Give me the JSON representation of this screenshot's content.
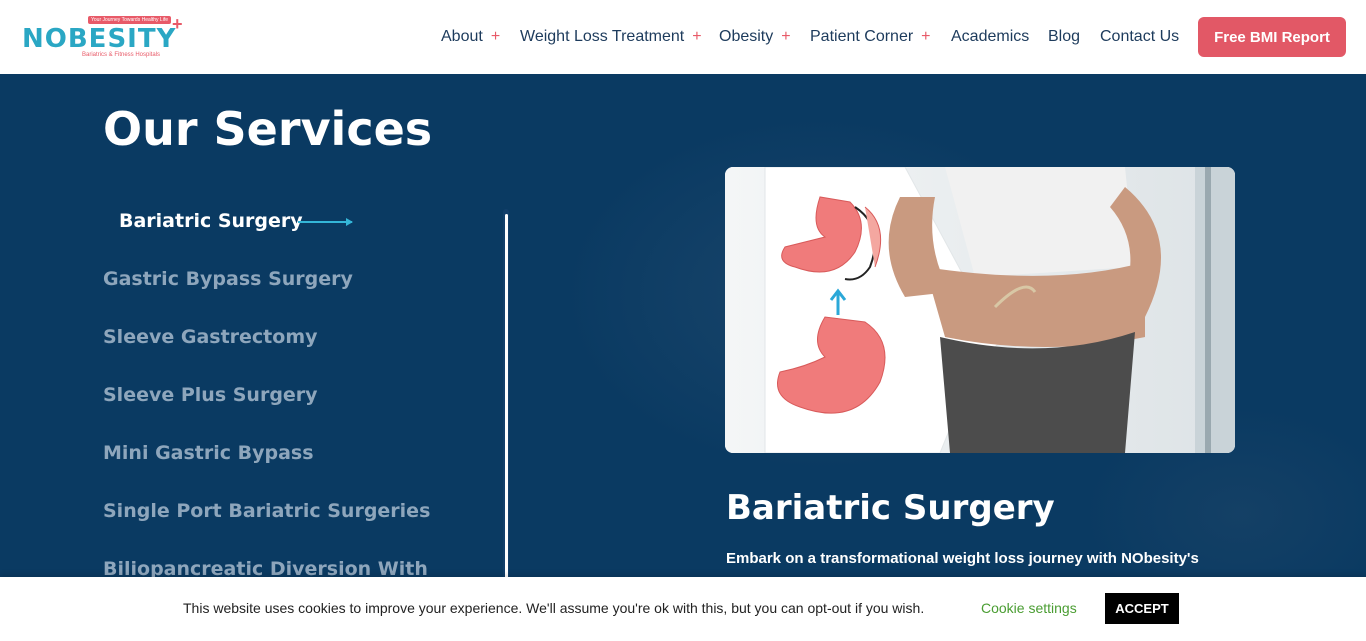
{
  "brand": {
    "name": "NOBESITY",
    "tagline": "Your Journey Towards Healthy Life",
    "subtitle": "Bariatrics & Fitness Hospitals"
  },
  "nav": [
    {
      "label": "About",
      "has_submenu": true
    },
    {
      "label": "Weight Loss Treatment",
      "has_submenu": true
    },
    {
      "label": "Obesity",
      "has_submenu": true
    },
    {
      "label": "Patient Corner",
      "has_submenu": true
    },
    {
      "label": "Academics",
      "has_submenu": false
    },
    {
      "label": "Blog",
      "has_submenu": false
    },
    {
      "label": "Contact Us",
      "has_submenu": false
    }
  ],
  "nav_plus": "+",
  "cta": {
    "label": "Free BMI Report"
  },
  "services": {
    "heading": "Our Services",
    "items": [
      "Bariatric Surgery",
      "Gastric Bypass Surgery",
      "Sleeve Gastrectomy",
      "Sleeve Plus Surgery",
      "Mini Gastric Bypass",
      "Single Port Bariatric Surgeries",
      "Biliopancreatic Diversion With"
    ],
    "active_index": 0,
    "selected": {
      "title": "Bariatric Surgery",
      "description": "Embark on a transformational weight loss journey with NObesity's"
    }
  },
  "cookie_bar": {
    "message": "This website uses cookies to improve your experience. We'll assume you're ok with this, but you can opt-out if you wish.",
    "settings_label": "Cookie settings",
    "accept_label": "ACCEPT"
  },
  "colors": {
    "primary_dark": "#0a3a62",
    "accent_pink": "#e25866",
    "accent_cyan": "#34b6d8",
    "cookie_link_green": "#4a9d32"
  }
}
